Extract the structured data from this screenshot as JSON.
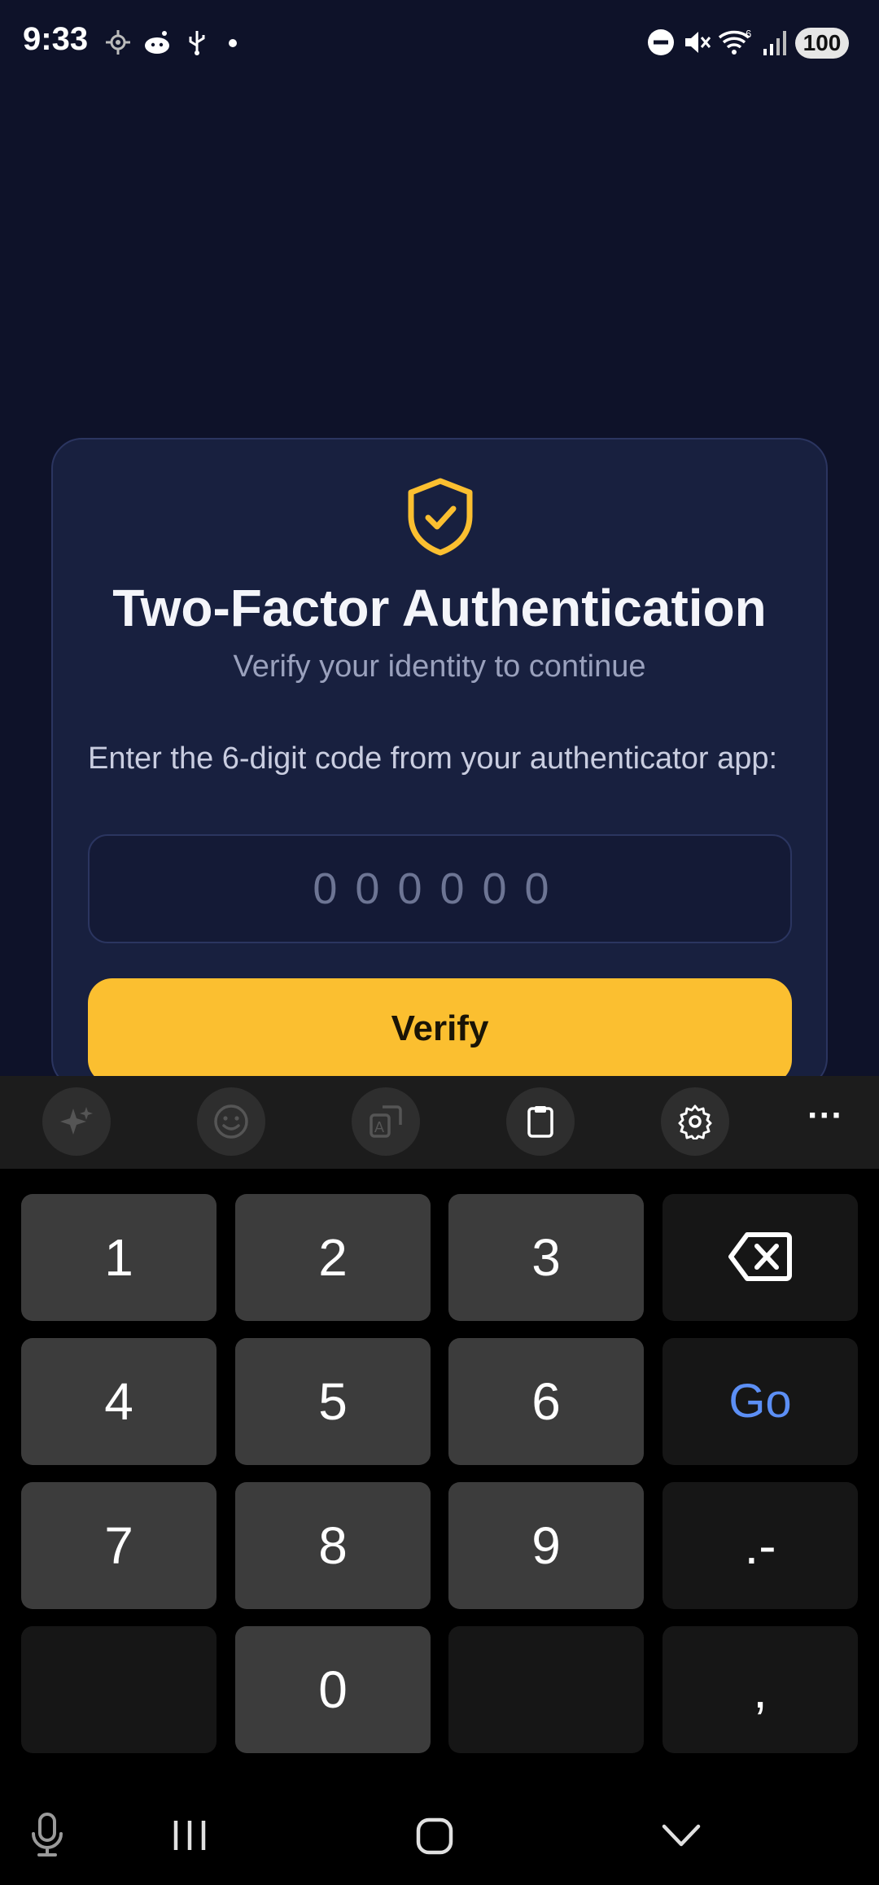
{
  "status_bar": {
    "time": "9:33",
    "battery": "100",
    "wifi_label": "6",
    "icons": [
      "location-icon",
      "reddit-icon",
      "usb-icon",
      "dot-icon",
      "dnd-icon",
      "mute-icon",
      "wifi-icon",
      "signal-icon",
      "battery-icon"
    ]
  },
  "auth": {
    "title": "Two-Factor Authentication",
    "subtitle": "Verify your identity to continue",
    "prompt": "Enter the 6-digit code from your authenticator app:",
    "code_placeholder": "000000",
    "verify_label": "Verify",
    "icon": "shield-check-icon",
    "accent": "#fbbf30"
  },
  "keyboard": {
    "toolbar": [
      "ai-sparkle-icon",
      "emoji-icon",
      "translate-icon",
      "clipboard-icon",
      "settings-icon",
      "more-icon"
    ],
    "more_label": "···",
    "keys": {
      "k1": "1",
      "k2": "2",
      "k3": "3",
      "k4": "4",
      "k5": "5",
      "k6": "6",
      "k7": "7",
      "k8": "8",
      "k9": "9",
      "k0": "0",
      "go": "Go",
      "symbols": ".-",
      "comma": ","
    }
  },
  "nav_bar": [
    "mic-icon",
    "recents-icon",
    "home-icon",
    "hide-keyboard-icon"
  ]
}
